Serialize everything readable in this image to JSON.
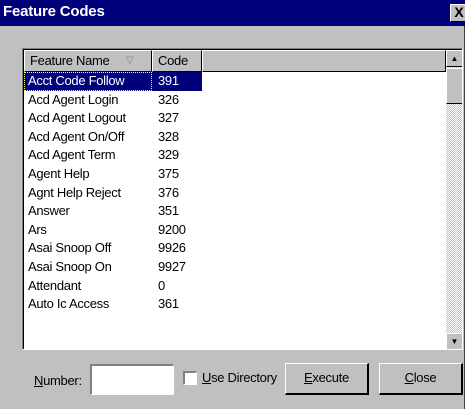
{
  "window": {
    "title": "Feature Codes",
    "close_glyph": "X"
  },
  "list": {
    "columns": [
      {
        "label": "Feature Name"
      },
      {
        "label": "Code"
      }
    ],
    "sort_indicator": "▽",
    "rows": [
      {
        "name": "Acct Code Follow",
        "code": "391"
      },
      {
        "name": "Acd Agent Login",
        "code": "326"
      },
      {
        "name": "Acd Agent Logout",
        "code": "327"
      },
      {
        "name": "Acd Agent On/Off",
        "code": "328"
      },
      {
        "name": "Acd Agent Term",
        "code": "329"
      },
      {
        "name": "Agent Help",
        "code": "375"
      },
      {
        "name": "Agnt Help Reject",
        "code": "376"
      },
      {
        "name": "Answer",
        "code": "351"
      },
      {
        "name": "Ars",
        "code": "9200"
      },
      {
        "name": "Asai Snoop Off",
        "code": "9926"
      },
      {
        "name": "Asai Snoop On",
        "code": "9927"
      },
      {
        "name": "Attendant",
        "code": "0"
      },
      {
        "name": "Auto Ic Access",
        "code": "361"
      }
    ],
    "selected_index": 0,
    "scroll_up_glyph": "▲",
    "scroll_down_glyph": "▼"
  },
  "controls": {
    "number_label_underlined": "N",
    "number_label_rest": "umber:",
    "number_value": "",
    "use_directory_underlined": "U",
    "use_directory_rest": "se Directory",
    "use_directory_checked": false,
    "execute_underlined": "E",
    "execute_rest": "xecute",
    "close_underlined": "C",
    "close_rest": "lose"
  },
  "colors": {
    "titlebar": "#00007b",
    "selection": "#00007b",
    "face": "#c0c0c0"
  }
}
